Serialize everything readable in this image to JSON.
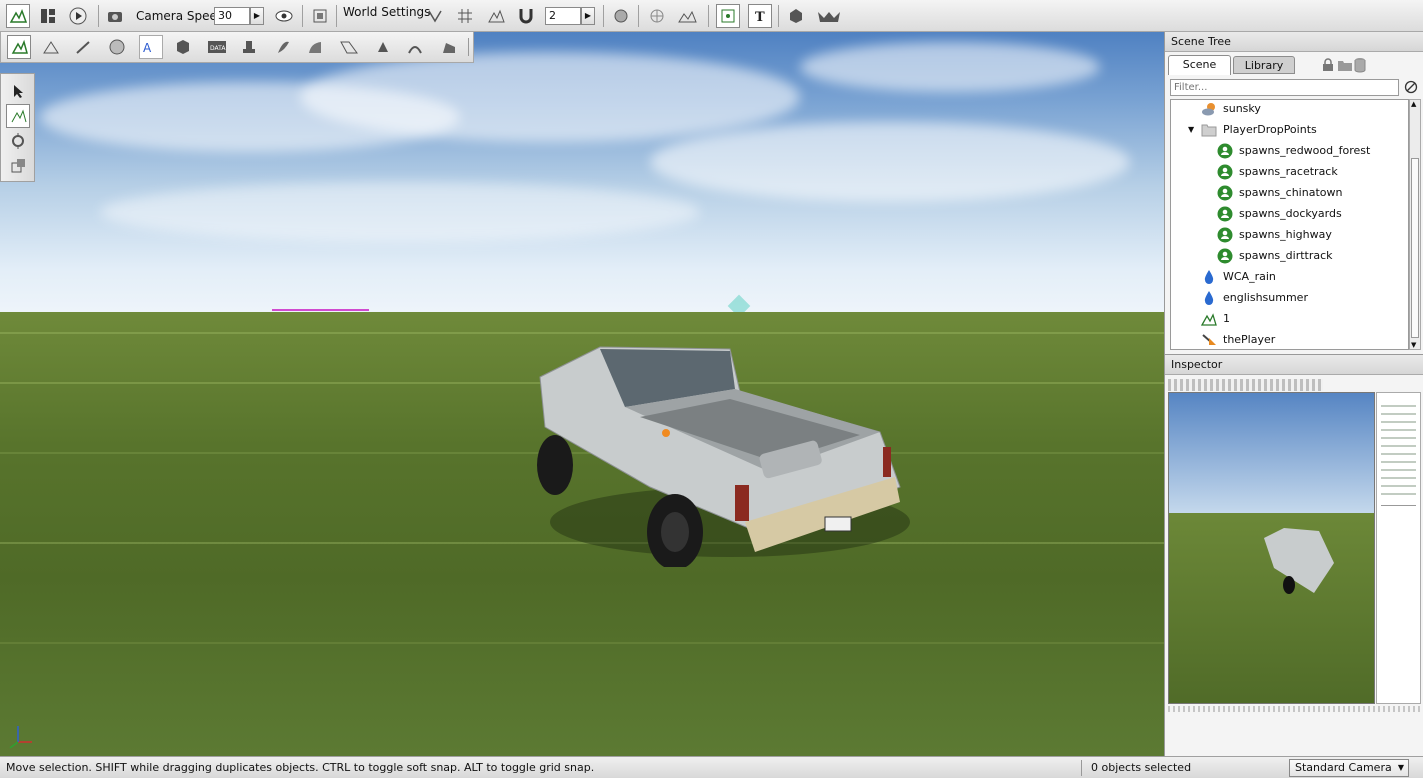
{
  "toolbar": {
    "camera_speed_label": "Camera Speed",
    "camera_speed_value": "30",
    "world_settings_label": "World Settings",
    "snap_value": "2"
  },
  "scene_tree": {
    "title": "Scene Tree",
    "tabs": [
      "Scene",
      "Library"
    ],
    "filter_placeholder": "Filter...",
    "items": [
      {
        "label": "sunsky",
        "icon": "sun-icon"
      },
      {
        "label": "PlayerDropPoints",
        "icon": "folder-icon"
      },
      {
        "label": "spawns_redwood_forest",
        "icon": "spawn-icon"
      },
      {
        "label": "spawns_racetrack",
        "icon": "spawn-icon"
      },
      {
        "label": "spawns_chinatown",
        "icon": "spawn-icon"
      },
      {
        "label": "spawns_dockyards",
        "icon": "spawn-icon"
      },
      {
        "label": "spawns_highway",
        "icon": "spawn-icon"
      },
      {
        "label": "spawns_dirttrack",
        "icon": "spawn-icon"
      },
      {
        "label": "WCA_rain",
        "icon": "raindrop-icon"
      },
      {
        "label": "englishsummer",
        "icon": "raindrop-icon"
      },
      {
        "label": "1",
        "icon": "terrain-icon"
      },
      {
        "label": "thePlayer",
        "icon": "camera-icon"
      }
    ]
  },
  "inspector": {
    "title": "Inspector"
  },
  "status": {
    "hint": "Move selection.  SHIFT while dragging duplicates objects.  CTRL to toggle soft snap.  ALT to toggle grid snap.",
    "selection": "0 objects selected",
    "camera": "Standard Camera"
  },
  "colors": {
    "accent_green": "#2e8b2e",
    "tab_active": "#ffffff",
    "tab_inactive": "#cfcfcf"
  }
}
